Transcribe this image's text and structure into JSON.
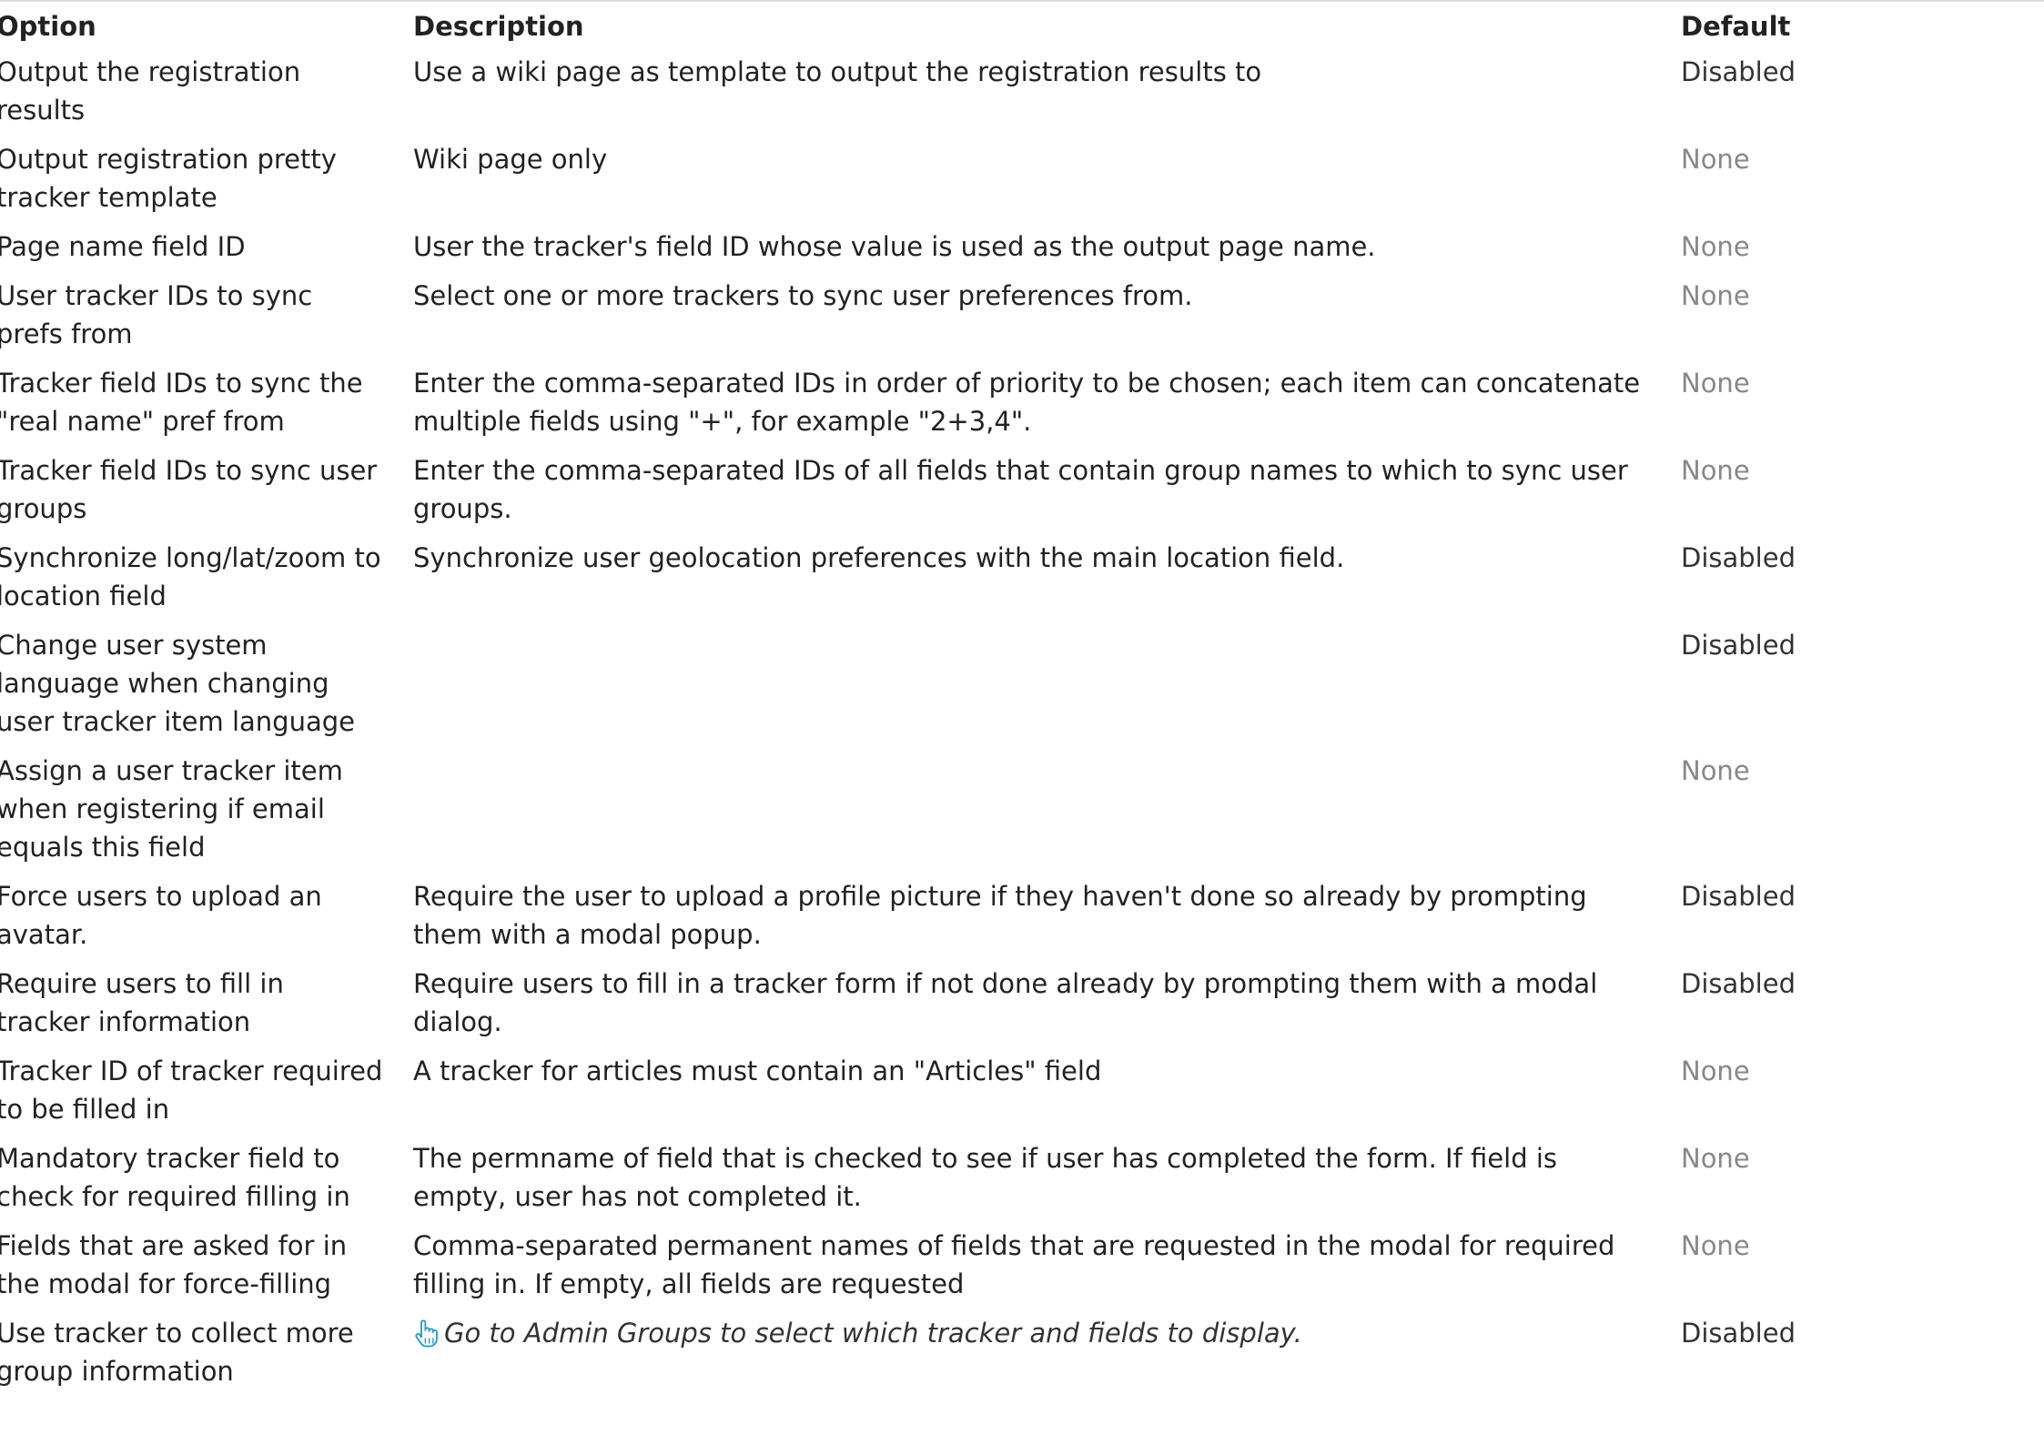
{
  "table": {
    "headers": {
      "option": "Option",
      "description": "Description",
      "default": "Default"
    },
    "rows": [
      {
        "option": "Output the registration results",
        "description": "Use a wiki page as template to output the registration results to",
        "default": "Disabled"
      },
      {
        "option": "Output registration pretty tracker template",
        "description": "Wiki page only",
        "default": "None"
      },
      {
        "option": "Page name field ID",
        "description": "User the tracker's field ID whose value is used as the output page name.",
        "default": "None"
      },
      {
        "option": "User tracker IDs to sync prefs from",
        "description": "Select one or more trackers to sync user preferences from.",
        "default": "None"
      },
      {
        "option": "Tracker field IDs to sync the \"real name\" pref from",
        "description": "Enter the comma-separated IDs in order of priority to be chosen; each item can concatenate multiple fields using \"+\", for example \"2+3,4\".",
        "default": "None"
      },
      {
        "option": "Tracker field IDs to sync user groups",
        "description": "Enter the comma-separated IDs of all fields that contain group names to which to sync user groups.",
        "default": "None"
      },
      {
        "option": "Synchronize long/lat/zoom to location field",
        "description": "Synchronize user geolocation preferences with the main location field.",
        "default": "Disabled"
      },
      {
        "option": "Change user system language when changing user tracker item language",
        "description": "",
        "default": "Disabled"
      },
      {
        "option": "Assign a user tracker item when registering if email equals this field",
        "description": "",
        "default": "None"
      },
      {
        "option": "Force users to upload an avatar.",
        "description": "Require the user to upload a profile picture if they haven't done so already by prompting them with a modal popup.",
        "default": "Disabled"
      },
      {
        "option": "Require users to fill in tracker information",
        "description": "Require users to fill in a tracker form if not done already by prompting them with a modal dialog.",
        "default": "Disabled"
      },
      {
        "option": "Tracker ID of tracker required to be filled in",
        "description": "A tracker for articles must contain an \"Articles\" field",
        "default": "None"
      },
      {
        "option": "Mandatory tracker field to check for required filling in",
        "description": "The permname of field that is checked to see if user has completed the form. If field is empty, user has not completed it.",
        "default": "None"
      },
      {
        "option": "Fields that are asked for in the modal for force-filling",
        "description": "Comma-separated permanent names of fields that are requested in the modal for required filling in. If empty, all fields are requested",
        "default": "None"
      },
      {
        "option": "Use tracker to collect more group information",
        "description": "Go to Admin Groups to select which tracker and fields to display.",
        "description_icon": "hand-pointer-icon",
        "default": "Disabled"
      }
    ]
  },
  "colors": {
    "text": "#222222",
    "none_default": "#888888",
    "icon": "#1a9bd7"
  }
}
